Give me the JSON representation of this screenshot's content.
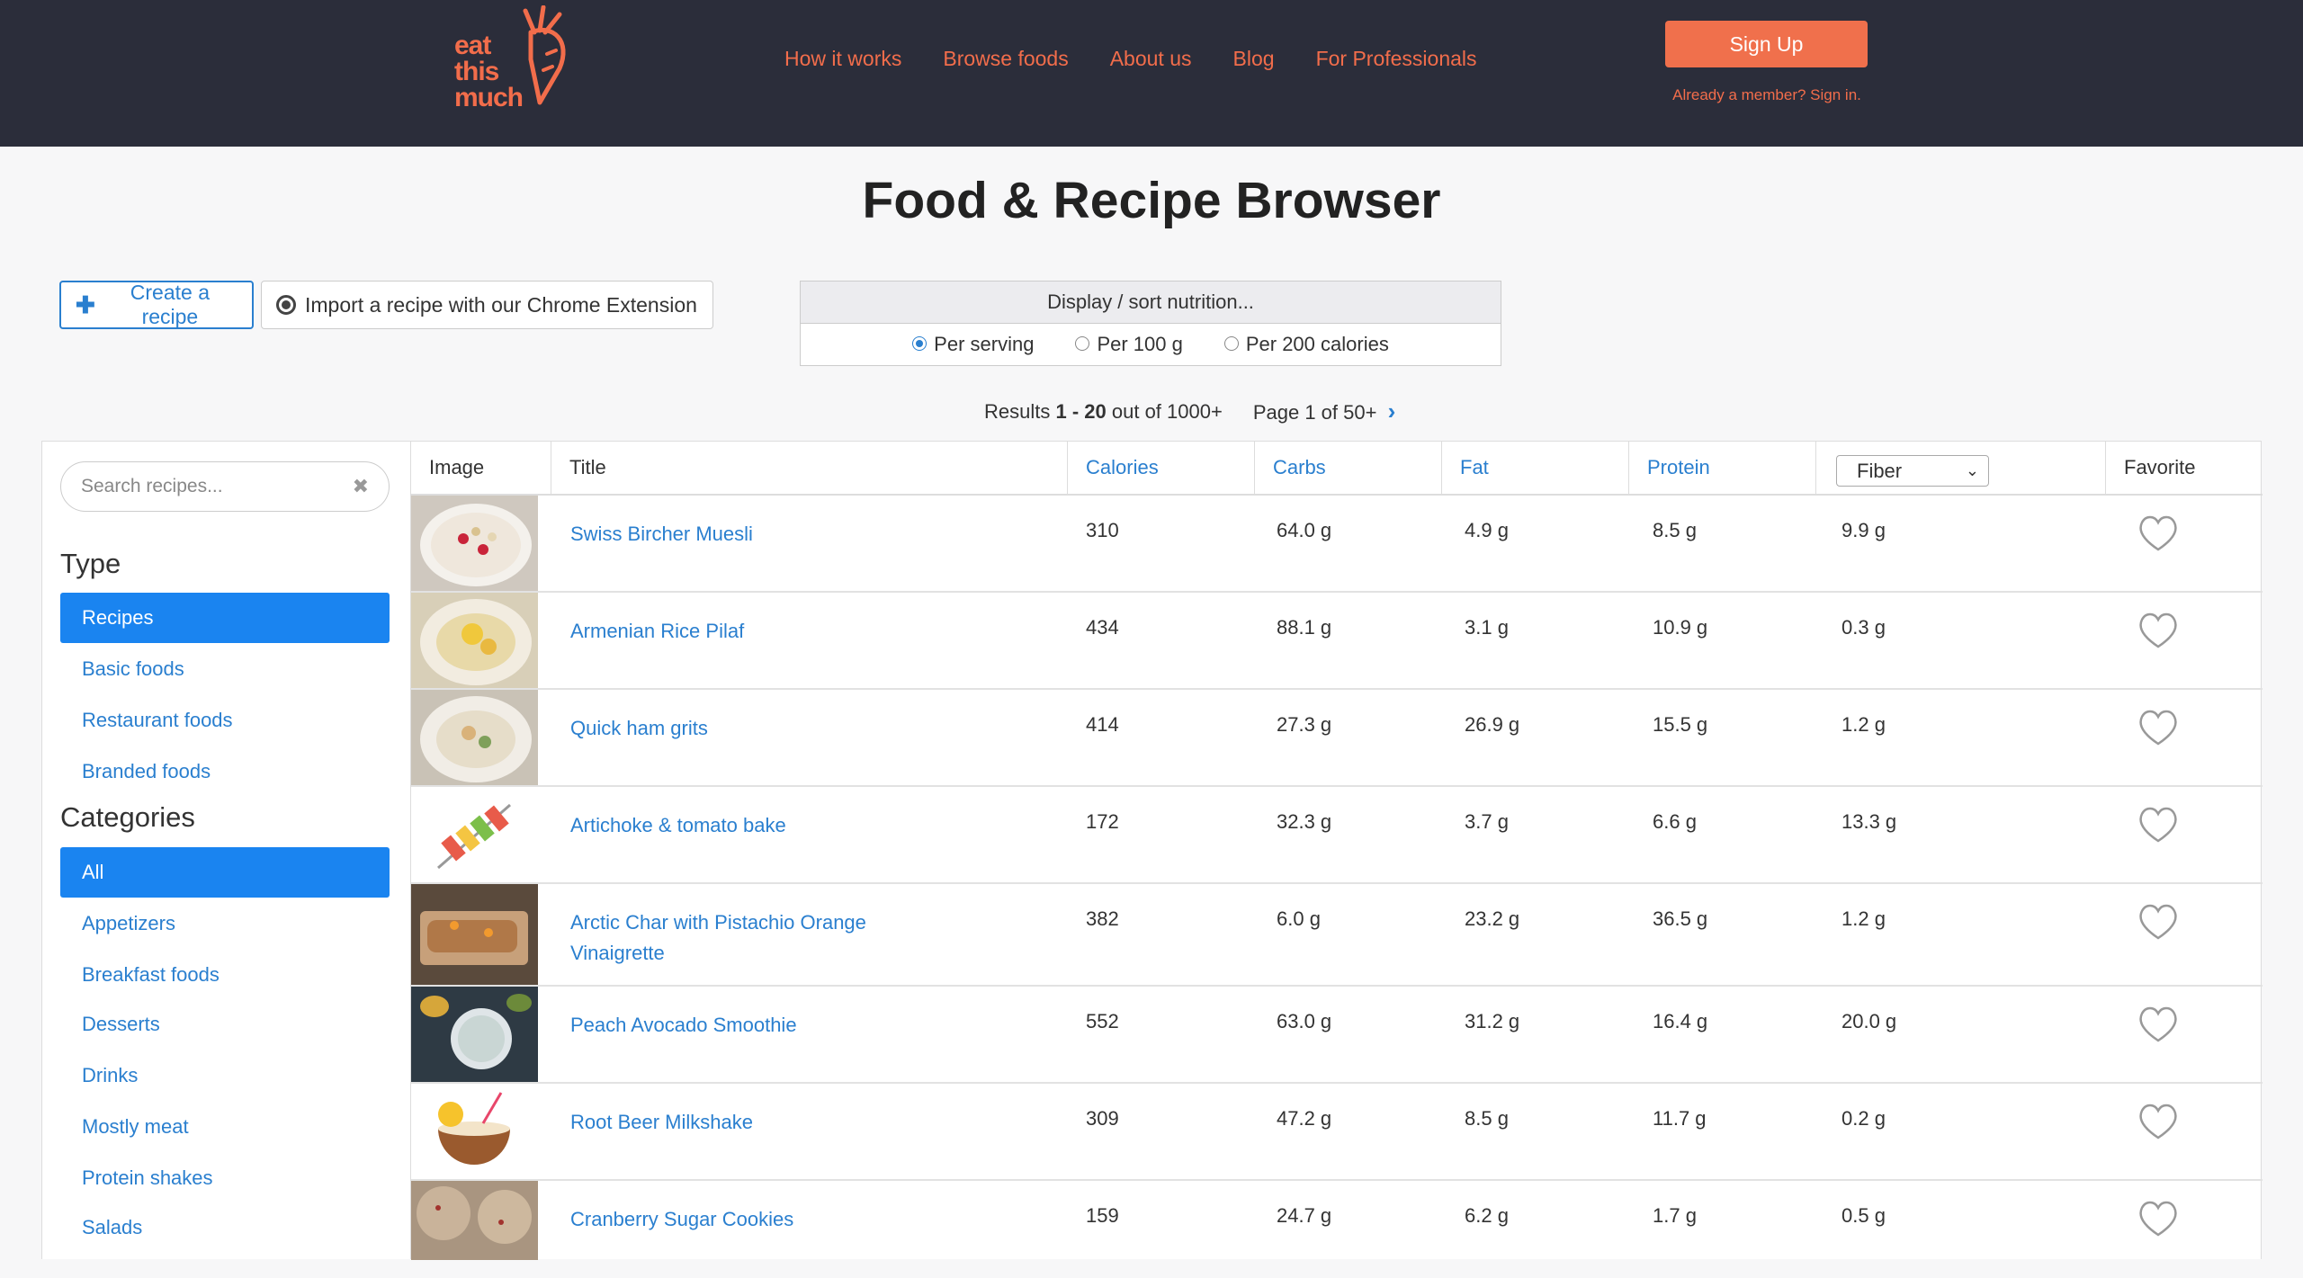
{
  "header": {
    "logo_lines": [
      "eat",
      "this",
      "much"
    ],
    "nav": [
      "How it works",
      "Browse foods",
      "About us",
      "Blog",
      "For Professionals"
    ],
    "signup_label": "Sign Up",
    "signin_text": "Already a member? Sign in."
  },
  "page_title": "Food & Recipe Browser",
  "actions": {
    "create_label": "Create a recipe",
    "import_label": "Import a recipe with our Chrome Extension"
  },
  "nutrition": {
    "heading": "Display / sort nutrition...",
    "options": [
      "Per serving",
      "Per 100 g",
      "Per 200 calories"
    ],
    "selected": "Per serving"
  },
  "results": {
    "prefix": "Results",
    "range": "1 - 20",
    "suffix": "out of 1000+",
    "page": "Page 1 of 50+"
  },
  "sidebar": {
    "search_placeholder": "Search recipes...",
    "type_title": "Type",
    "types": [
      "Recipes",
      "Basic foods",
      "Restaurant foods",
      "Branded foods"
    ],
    "categories_title": "Categories",
    "categories": [
      "All",
      "Appetizers",
      "Breakfast foods",
      "Desserts",
      "Drinks",
      "Mostly meat",
      "Protein shakes",
      "Salads"
    ]
  },
  "table": {
    "headers": {
      "image": "Image",
      "title": "Title",
      "calories": "Calories",
      "carbs": "Carbs",
      "fat": "Fat",
      "protein": "Protein",
      "fiber": "Fiber",
      "favorite": "Favorite"
    },
    "rows": [
      {
        "title": "Swiss Bircher Muesli",
        "calories": "310",
        "carbs": "64.0 g",
        "fat": "4.9 g",
        "protein": "8.5 g",
        "fiber": "9.9 g"
      },
      {
        "title": "Armenian Rice Pilaf",
        "calories": "434",
        "carbs": "88.1 g",
        "fat": "3.1 g",
        "protein": "10.9 g",
        "fiber": "0.3 g"
      },
      {
        "title": "Quick ham grits",
        "calories": "414",
        "carbs": "27.3 g",
        "fat": "26.9 g",
        "protein": "15.5 g",
        "fiber": "1.2 g"
      },
      {
        "title": "Artichoke & tomato bake",
        "calories": "172",
        "carbs": "32.3 g",
        "fat": "3.7 g",
        "protein": "6.6 g",
        "fiber": "13.3 g"
      },
      {
        "title": "Arctic Char with Pistachio Orange Vinaigrette",
        "calories": "382",
        "carbs": "6.0 g",
        "fat": "23.2 g",
        "protein": "36.5 g",
        "fiber": "1.2 g"
      },
      {
        "title": "Peach Avocado Smoothie",
        "calories": "552",
        "carbs": "63.0 g",
        "fat": "31.2 g",
        "protein": "16.4 g",
        "fiber": "20.0 g"
      },
      {
        "title": "Root Beer Milkshake",
        "calories": "309",
        "carbs": "47.2 g",
        "fat": "8.5 g",
        "protein": "11.7 g",
        "fiber": "0.2 g"
      },
      {
        "title": "Cranberry Sugar Cookies",
        "calories": "159",
        "carbs": "24.7 g",
        "fat": "6.2 g",
        "protein": "1.7 g",
        "fiber": "0.5 g"
      }
    ]
  },
  "colors": {
    "brand_orange": "#f26d4b",
    "header_bg": "#2b2d3a",
    "link_blue": "#2a7fcf",
    "active_blue": "#1a84f0"
  }
}
